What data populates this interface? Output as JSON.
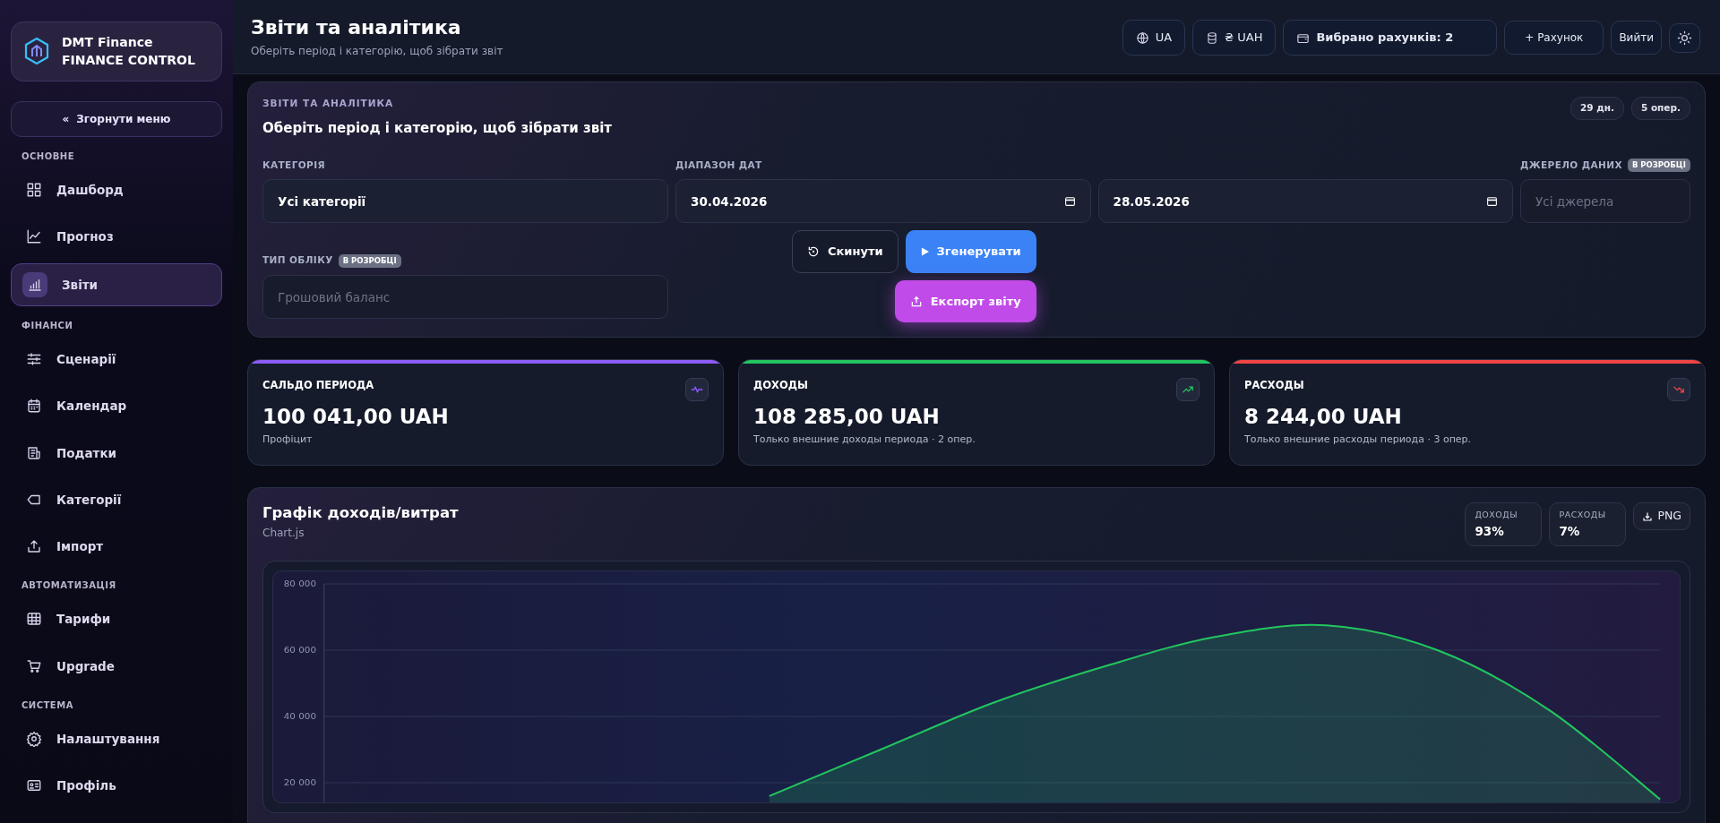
{
  "brand": {
    "name": "DMT Finance",
    "subtitle": "FINANCE CONTROL"
  },
  "collapse_button": {
    "glyph": "«",
    "label": "Згорнути меню"
  },
  "sidebar": {
    "sections": [
      {
        "title": "ОСНОВНЕ",
        "items": [
          {
            "label": "Дашборд",
            "selected": false
          },
          {
            "label": "Прогноз",
            "selected": false
          },
          {
            "label": "Звіти",
            "selected": true
          }
        ]
      },
      {
        "title": "ФІНАНСИ",
        "items": [
          {
            "label": "Сценарії",
            "selected": false
          },
          {
            "label": "Календар",
            "selected": false
          },
          {
            "label": "Податки",
            "selected": false
          },
          {
            "label": "Категорії",
            "selected": false
          },
          {
            "label": "Імпорт",
            "selected": false
          }
        ]
      },
      {
        "title": "АВТОМАТИЗАЦІЯ",
        "items": [
          {
            "label": "Тарифи",
            "selected": false
          },
          {
            "label": "Upgrade",
            "selected": false
          }
        ]
      },
      {
        "title": "СИСТЕМА",
        "items": [
          {
            "label": "Налаштування",
            "selected": false
          },
          {
            "label": "Профіль",
            "selected": false
          }
        ]
      }
    ]
  },
  "header": {
    "title": "Звіти та аналітика",
    "subtitle": "Оберіть період і категорію, щоб зібрати звіт",
    "language": "UA",
    "currency": "₴ UAH",
    "accounts": "Вибрано рахунків: 2",
    "add_account": "+ Рахунок",
    "logout": "Вийти"
  },
  "filters": {
    "eyebrow": "ЗВІТИ ТА АНАЛІТИКА",
    "heading": "Оберіть період і категорію, щоб зібрати звіт",
    "badges": [
      "29 дн.",
      "5 опер."
    ],
    "category": {
      "label": "КАТЕГОРІЯ",
      "value": "Усі категорії"
    },
    "date_range": {
      "label": "ДІАПАЗОН ДАТ",
      "from": "30.04.2026",
      "to": "28.05.2026"
    },
    "source": {
      "label": "ДЖЕРЕЛО ДАНИХ",
      "badge": "В РОЗРОБЦІ",
      "placeholder": "Усі джерела",
      "disabled": true
    },
    "accounting_type": {
      "label": "ТИП ОБЛІКУ",
      "badge": "В РОЗРОБЦІ",
      "placeholder": "Грошовий баланс",
      "disabled": true
    },
    "reset_button": "Скинути",
    "generate_button": "Згенерувати",
    "export_button": "Експорт звіту"
  },
  "kpis": [
    {
      "title": "САЛЬДО ПЕРИОДА",
      "value": "100 041,00 UAH",
      "note": "Профіцит",
      "color": "#8b5cf6"
    },
    {
      "title": "ДОХОДЫ",
      "value": "108 285,00 UAH",
      "note": "Только внешние доходы периода · 2 опер.",
      "color": "#22c55e"
    },
    {
      "title": "РАСХОДЫ",
      "value": "8 244,00 UAH",
      "note": "Только внешние расходы периода · 3 опер.",
      "color": "#ef4444"
    }
  ],
  "chart_card": {
    "title": "Графік доходів/витрат",
    "subtitle": "Chart.js",
    "stats": [
      {
        "label": "ДОХОДЫ",
        "value": "93%"
      },
      {
        "label": "РАСХОДЫ",
        "value": "7%"
      }
    ],
    "png_button": "PNG",
    "chart_data": {
      "type": "area",
      "grid": true,
      "yticks": [
        {
          "value": 20000,
          "label": "20 000"
        },
        {
          "value": 40000,
          "label": "40 000"
        },
        {
          "value": 60000,
          "label": "60 000"
        },
        {
          "value": 80000,
          "label": "80 000"
        }
      ],
      "ylim": [
        14000,
        80000
      ],
      "series": [
        {
          "color": "#22c55e",
          "values": [
            null,
            null,
            null,
            null,
            16000,
            30000,
            44000,
            55000,
            64000,
            67500,
            60000,
            42000,
            15000
          ]
        }
      ]
    }
  }
}
